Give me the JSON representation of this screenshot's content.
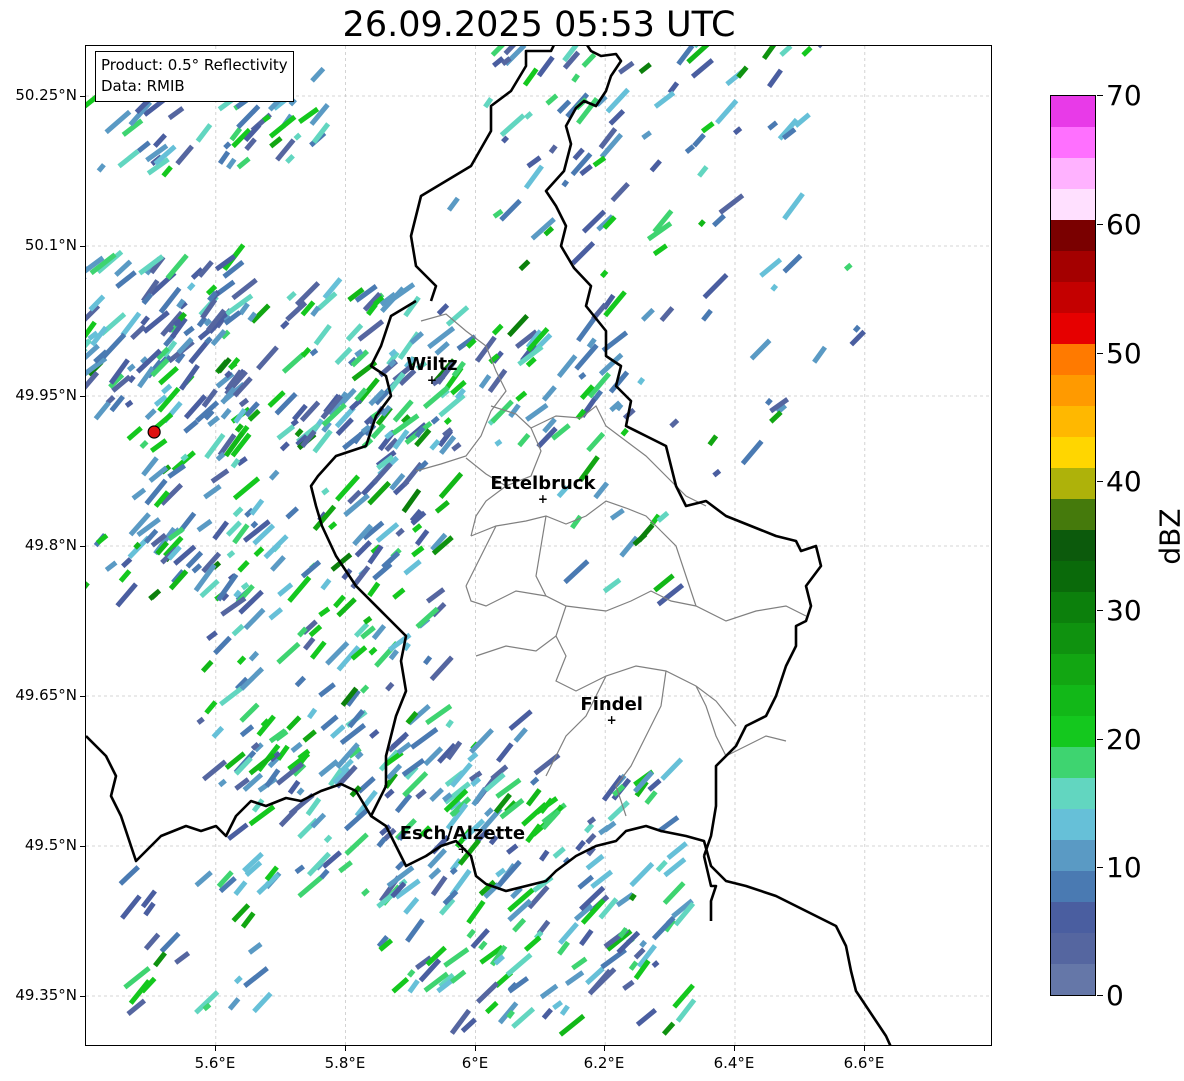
{
  "title": "26.09.2025 05:53 UTC",
  "info": {
    "product": "Product: 0.5° Reflectivity",
    "data": "Data: RMIB"
  },
  "map": {
    "lon_range": [
      5.4,
      6.8
    ],
    "lat_range": [
      49.3,
      50.3
    ],
    "lon_ticks": [
      "5.6°E",
      "5.8°E",
      "6°E",
      "6.2°E",
      "6.4°E",
      "6.6°E"
    ],
    "lat_ticks": [
      "50.25°N",
      "50.1°N",
      "49.95°N",
      "49.8°N",
      "49.65°N",
      "49.5°N",
      "49.35°N"
    ],
    "grid": true,
    "radar_site": {
      "lon": 5.505,
      "lat": 49.914,
      "color": "#e01010"
    },
    "cities": [
      {
        "name": "Wiltz",
        "lon": 5.933,
        "lat": 49.966
      },
      {
        "name": "Ettelbruck",
        "lon": 6.104,
        "lat": 49.847
      },
      {
        "name": "Findel",
        "lon": 6.21,
        "lat": 49.626
      },
      {
        "name": "Esch/Alzette",
        "lon": 5.98,
        "lat": 49.497
      }
    ]
  },
  "colorbar": {
    "label": "dBZ",
    "min": 0,
    "max": 70,
    "ticks": [
      "70",
      "60",
      "50",
      "40",
      "30",
      "20",
      "10",
      "0"
    ],
    "colors": [
      "#6577a8",
      "#5566a0",
      "#4a5ea0",
      "#4a7ab2",
      "#5a9ac4",
      "#66c0d8",
      "#62d6c0",
      "#3ed470",
      "#14c81e",
      "#12b818",
      "#12a612",
      "#0f920f",
      "#0c800c",
      "#0a6a0a",
      "#0c5a0c",
      "#457a0c",
      "#aeb20a",
      "#ffd600",
      "#ffb800",
      "#ff9a00",
      "#ff7a00",
      "#e60000",
      "#c40000",
      "#a40000",
      "#7a0000",
      "#ffe0ff",
      "#ffb2ff",
      "#ff70ff",
      "#e83ae8"
    ]
  }
}
